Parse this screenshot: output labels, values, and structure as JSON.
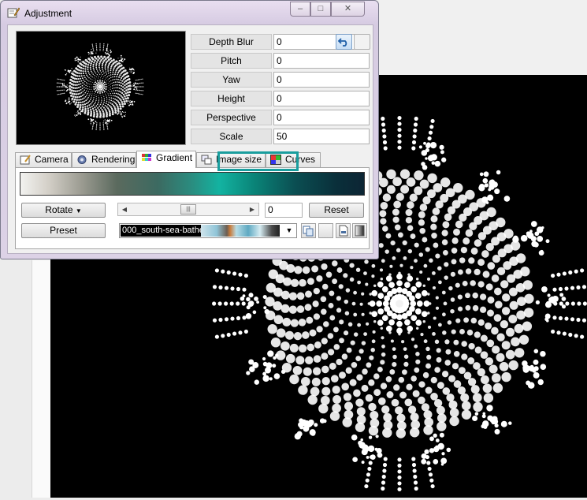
{
  "window": {
    "title": "Adjustment",
    "icons": {
      "title": "edit-icon",
      "minimize": "minimize-icon",
      "maximize": "maximize-icon",
      "close": "close-icon"
    }
  },
  "params": [
    {
      "label": "Depth Blur",
      "value": "0"
    },
    {
      "label": "Pitch",
      "value": "0"
    },
    {
      "label": "Yaw",
      "value": "0"
    },
    {
      "label": "Height",
      "value": "0"
    },
    {
      "label": "Perspective",
      "value": "0"
    },
    {
      "label": "Scale",
      "value": "50"
    }
  ],
  "tabs": [
    {
      "label": "Camera",
      "icon": "camera-icon"
    },
    {
      "label": "Rendering",
      "icon": "gear-icon"
    },
    {
      "label": "Gradient",
      "icon": "palette-icon",
      "active": true
    },
    {
      "label": "Image size",
      "icon": "image-size-icon"
    },
    {
      "label": "Curves",
      "icon": "curves-icon"
    }
  ],
  "gradient": {
    "rotate_label": "Rotate",
    "rotate_value": "0",
    "reset_label": "Reset",
    "preset_label": "Preset",
    "preset_selected": "000_south-sea-bathe"
  },
  "colors": {
    "highlight": "#1a9e9e",
    "accent_teal": "#13b3a1"
  }
}
